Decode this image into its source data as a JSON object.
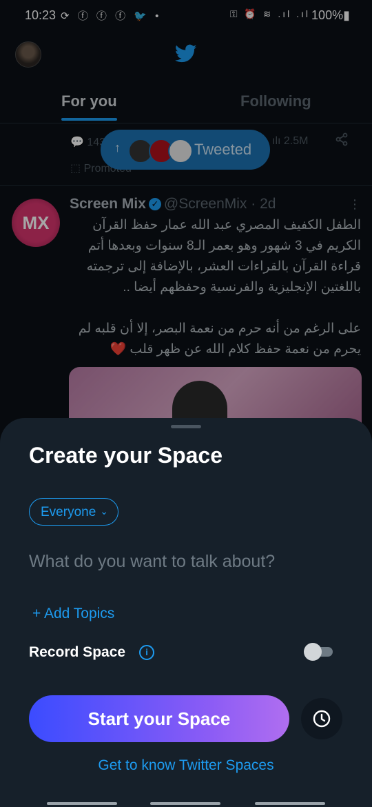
{
  "status_bar": {
    "time": "10:23",
    "left_icons": "⟳ ⓕ ⓕ ⓕ 🐦 •",
    "right_icons": "⚿ ⏰ ≋ .ıl .ıl",
    "battery": "100%▮"
  },
  "header": {
    "logo": "twitter-bird-icon"
  },
  "tabs": [
    {
      "label": "For you"
    },
    {
      "label": "Following"
    }
  ],
  "feed": {
    "previous_tweet": {
      "replies": "143",
      "views": "2.5M",
      "promoted": "Promoted"
    },
    "tweeted_pill": {
      "label": "Tweeted"
    },
    "tweet": {
      "avatar_text": "MX",
      "name": "Screen Mix",
      "handle_time": "@ScreenMix · 2d",
      "text": "الطفل الكفيف المصري عبد الله عمار حفظ القرآن الكريم في 3 شهور وهو بعمر الـ8 سنوات وبعدها أتم قراءة القرآن بالقراءات العشر، بالإضافة إلى ترجمته باللغتين الإنجليزية والفرنسية وحفظهم أيضا ..\n\nعلى الرغم من أنه حرم من نعمة البصر، إلا أن قلبه لم يحرم من نعمة حفظ كلام الله عن ظهر قلب ❤️"
    }
  },
  "sheet": {
    "title": "Create your Space",
    "audience": "Everyone",
    "topic_placeholder": "What do you want to talk about?",
    "add_topics": "+ Add Topics",
    "record_label": "Record Space",
    "record_enabled": false,
    "start_button": "Start your Space",
    "learn_link": "Get to know Twitter Spaces"
  },
  "colors": {
    "accent": "#1d9bf0",
    "sheet_bg": "#16202a"
  }
}
